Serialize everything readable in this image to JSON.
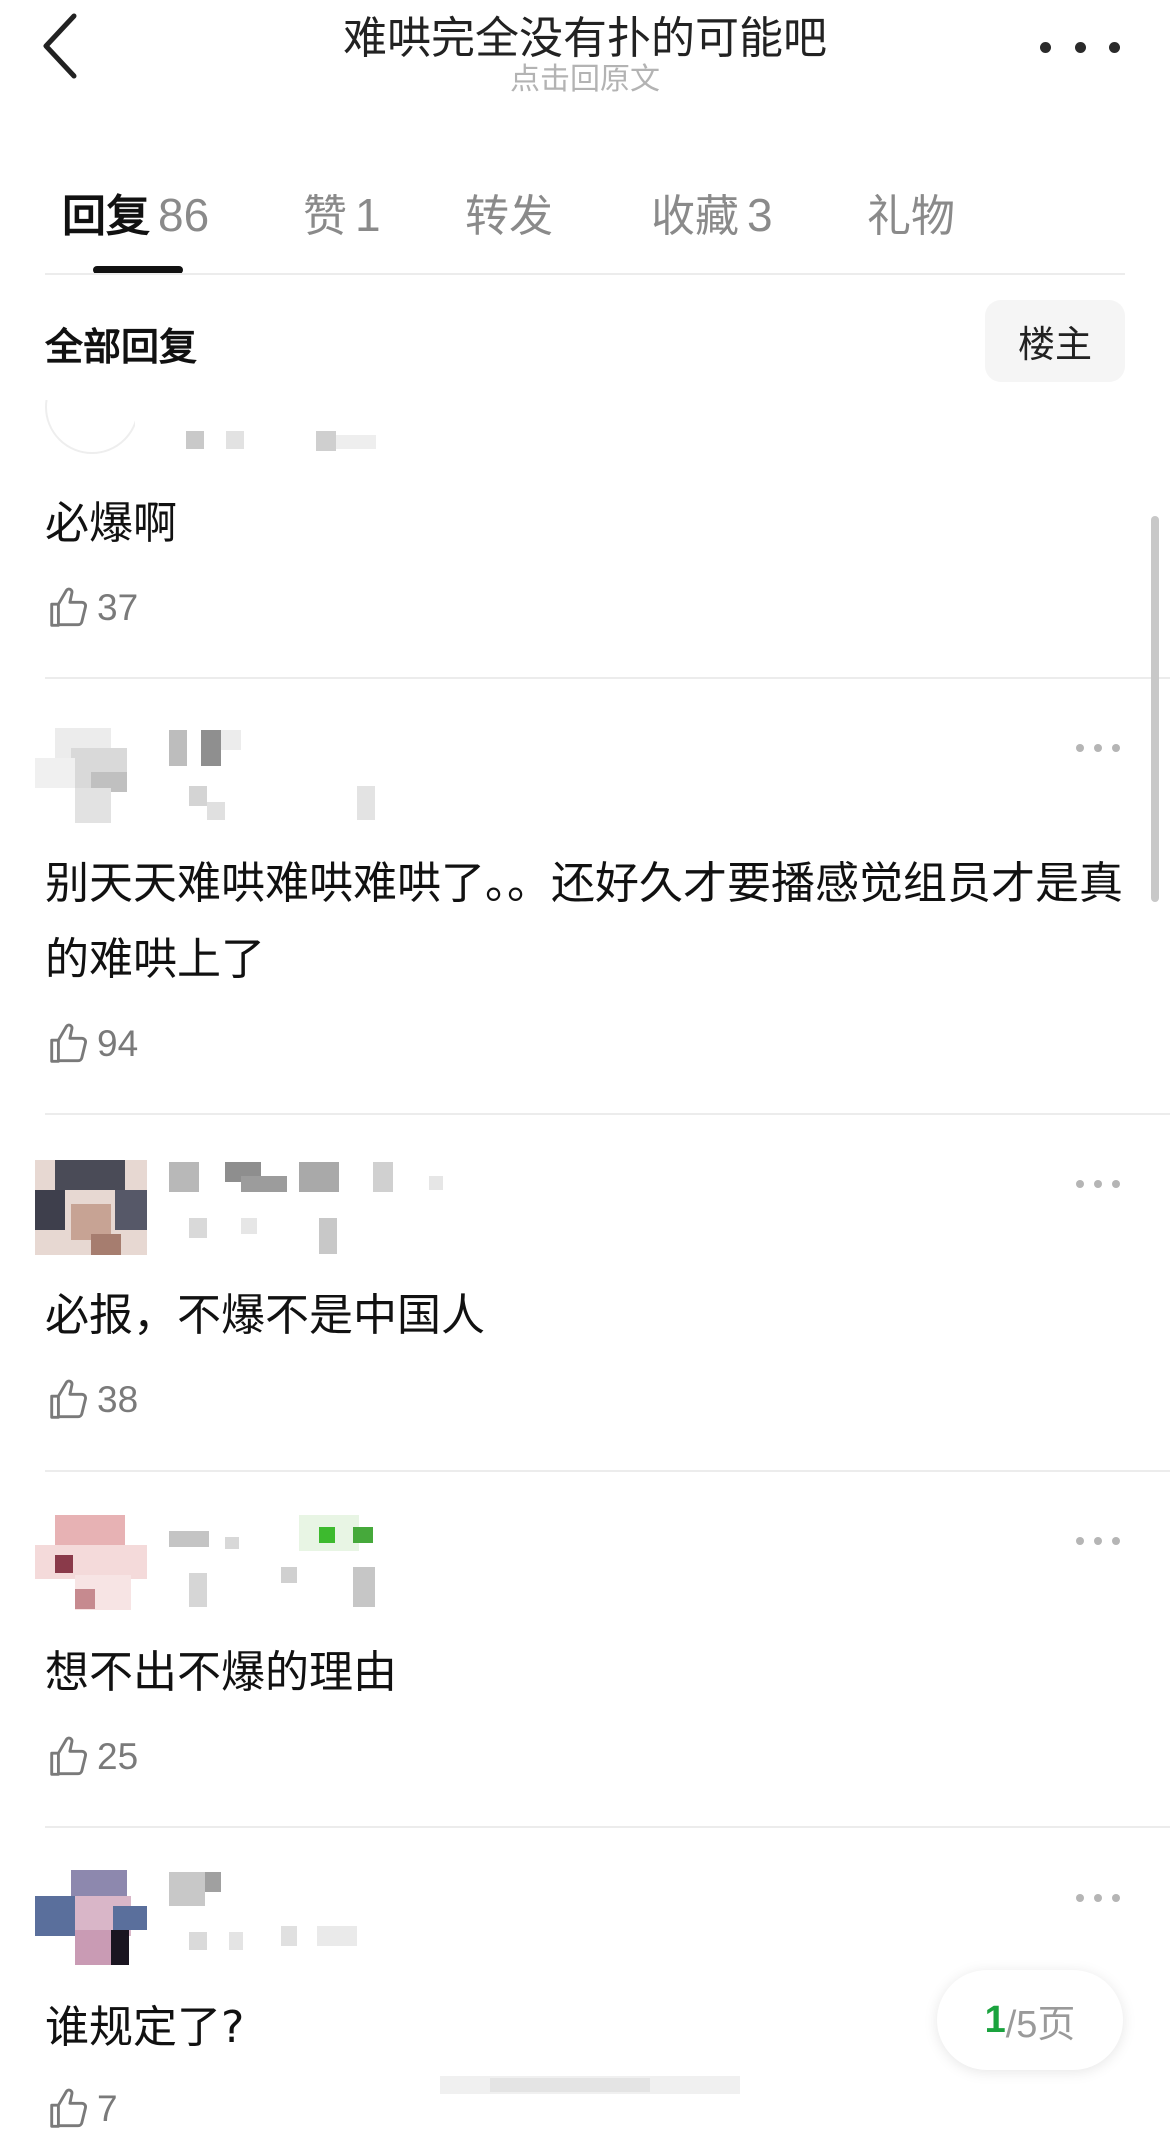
{
  "header": {
    "title": "难哄完全没有扑的可能吧",
    "subtitle": "点击回原文"
  },
  "tabs": [
    {
      "label": "回复",
      "count": "86"
    },
    {
      "label": "赞",
      "count": "1"
    },
    {
      "label": "转发",
      "count": ""
    },
    {
      "label": "收藏",
      "count": "3"
    },
    {
      "label": "礼物",
      "count": ""
    }
  ],
  "section": {
    "title": "全部回复",
    "op_button": "楼主"
  },
  "comments": [
    {
      "content": "必爆啊",
      "likes": "37"
    },
    {
      "content": "别天天难哄难哄难哄了。。还好久才要播感觉组员才是真的难哄上了",
      "likes": "94"
    },
    {
      "content": "必报，不爆不是中国人",
      "likes": "38"
    },
    {
      "content": "想不出不爆的理由",
      "likes": "25"
    },
    {
      "content": "谁规定了?",
      "likes": "7"
    }
  ],
  "pager": {
    "current": "1",
    "total_text": "/5页"
  },
  "colors": {
    "accent_green": "#1aa33e",
    "divider": "#ececec"
  },
  "icons": [
    "chevron-left-icon",
    "more-horizontal-icon",
    "thumbs-up-icon"
  ]
}
